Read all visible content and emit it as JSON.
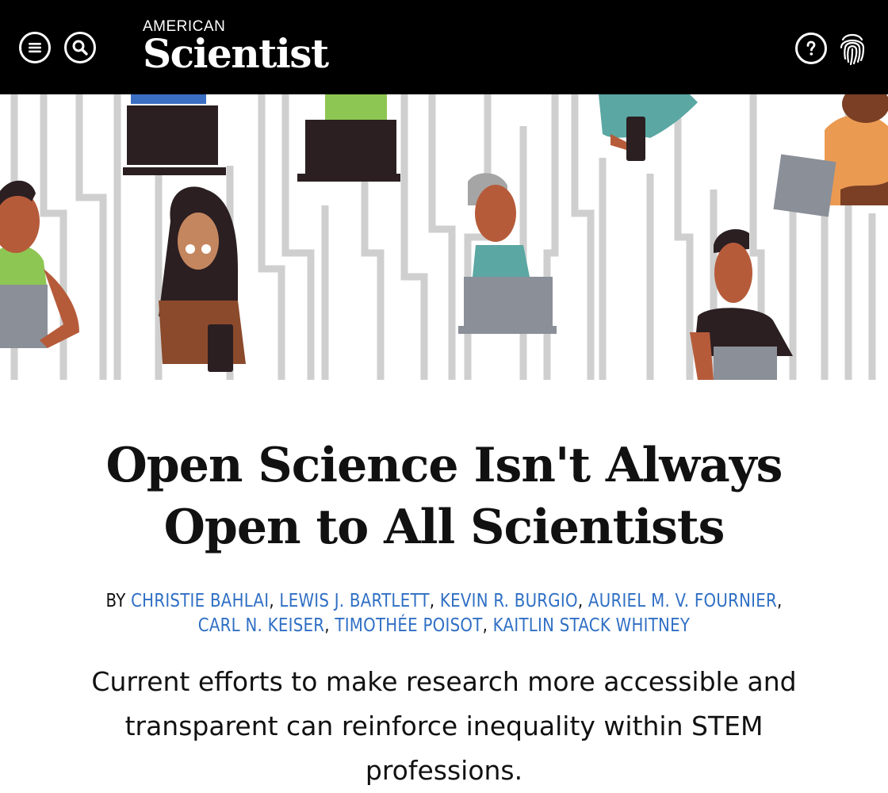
{
  "header": {
    "logo_top": "AMERICAN",
    "logo_main": "Scientist",
    "menu_icon": "menu-icon",
    "search_icon": "search-icon",
    "help_icon": "help-icon",
    "fingerprint_icon": "fingerprint-icon"
  },
  "article": {
    "title_line1": "Open Science Isn't Always",
    "title_line2": "Open to All Scientists",
    "by_label": "BY",
    "authors": [
      "CHRISTIE BAHLAI",
      "LEWIS J. BARTLETT",
      "KEVIN R. BURGIO",
      "AURIEL M. V. FOURNIER",
      "CARL N. KEISER",
      "TIMOTHÉE POISOT",
      "KAITLIN STACK WHITNEY"
    ],
    "dek_line1": "Current efforts to make research more accessible and",
    "dek_line2": "transparent can reinforce inequality within STEM",
    "dek_line3": "professions."
  },
  "colors": {
    "topbar": "#000000",
    "link": "#2f6fc4"
  }
}
